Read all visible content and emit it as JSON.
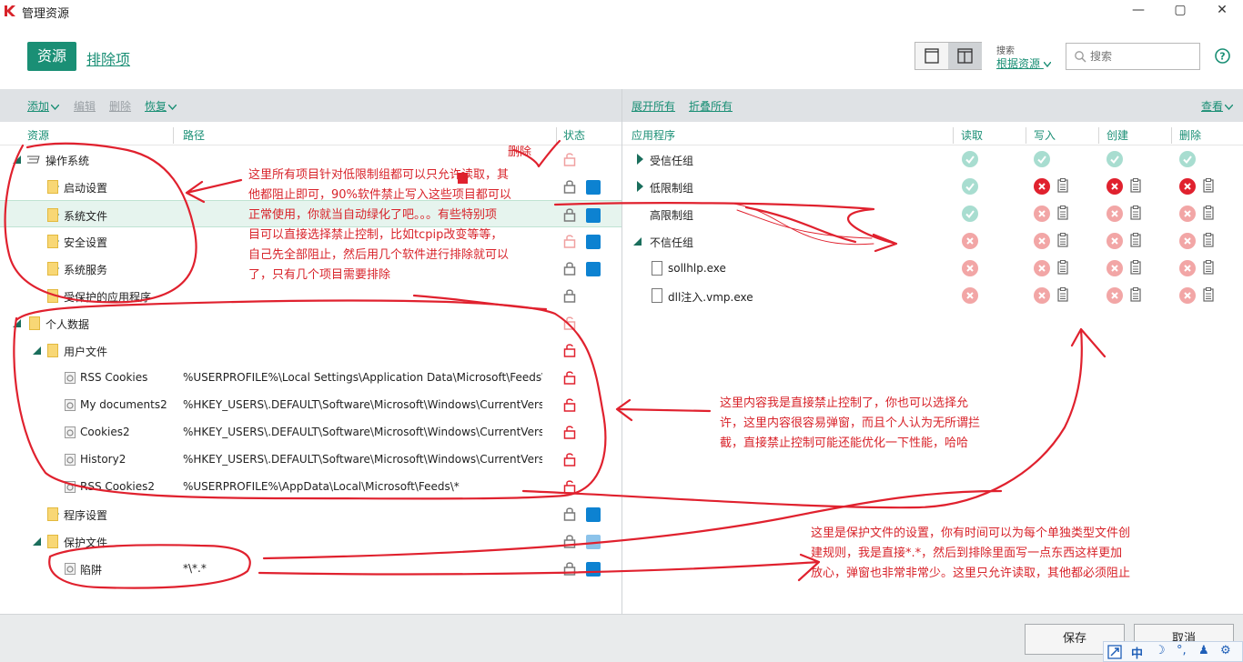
{
  "window": {
    "title": "管理资源",
    "minimize": "—",
    "maximize": "▢",
    "close": "✕"
  },
  "header": {
    "tab_resources": "资源",
    "tab_exclusions": "排除项",
    "search_caption": "搜索",
    "search_mode": "根据资源",
    "search_placeholder": "搜索"
  },
  "toolbar": {
    "add": "添加",
    "edit": "编辑",
    "delete": "删除",
    "restore": "恢复",
    "expand_all": "展开所有",
    "collapse_all": "折叠所有",
    "view": "查看"
  },
  "left_columns": {
    "resource": "资源",
    "path": "路径",
    "status": "状态"
  },
  "right_columns": {
    "app": "应用程序",
    "read": "读取",
    "write": "写入",
    "create": "创建",
    "delete": "删除"
  },
  "tree": [
    {
      "label": "操作系统",
      "path": "",
      "level": 0,
      "expand": "open",
      "icon": "computer-icon",
      "lock": "open-light",
      "square": "none"
    },
    {
      "label": "启动设置",
      "path": "",
      "level": 1,
      "expand": "closed",
      "icon": "folder-icon",
      "lock": "closed",
      "square": "blue"
    },
    {
      "label": "系统文件",
      "path": "",
      "level": 1,
      "expand": "closed",
      "icon": "folder-icon",
      "lock": "closed",
      "square": "blue",
      "selected": true
    },
    {
      "label": "安全设置",
      "path": "",
      "level": 1,
      "expand": "closed",
      "icon": "folder-icon",
      "lock": "open-light",
      "square": "blue"
    },
    {
      "label": "系统服务",
      "path": "",
      "level": 1,
      "expand": "closed",
      "icon": "folder-icon",
      "lock": "closed",
      "square": "blue"
    },
    {
      "label": "受保护的应用程序",
      "path": "",
      "level": 1,
      "expand": "closed",
      "icon": "folder-icon",
      "lock": "closed",
      "square": "none"
    },
    {
      "label": "个人数据",
      "path": "",
      "level": 0,
      "expand": "open",
      "icon": "folder-icon",
      "lock": "open-light",
      "square": "none"
    },
    {
      "label": "用户文件",
      "path": "",
      "level": 1,
      "expand": "open",
      "icon": "folder-icon",
      "lock": "open-red",
      "square": "none"
    },
    {
      "label": "RSS Cookies",
      "path": "%USERPROFILE%\\Local Settings\\Application Data\\Microsoft\\Feeds\\*",
      "level": 2,
      "expand": "none",
      "icon": "gear-icon",
      "lock": "open-red",
      "square": "none"
    },
    {
      "label": "My documents2",
      "path": "%HKEY_USERS\\.DEFAULT\\Software\\Microsoft\\Windows\\CurrentVersion\\E...",
      "level": 2,
      "expand": "none",
      "icon": "gear-icon",
      "lock": "open-red",
      "square": "none"
    },
    {
      "label": "Cookies2",
      "path": "%HKEY_USERS\\.DEFAULT\\Software\\Microsoft\\Windows\\CurrentVersion\\E...",
      "level": 2,
      "expand": "none",
      "icon": "gear-icon",
      "lock": "open-red",
      "square": "none"
    },
    {
      "label": "History2",
      "path": "%HKEY_USERS\\.DEFAULT\\Software\\Microsoft\\Windows\\CurrentVersion\\E...",
      "level": 2,
      "expand": "none",
      "icon": "gear-icon",
      "lock": "open-red",
      "square": "none"
    },
    {
      "label": "RSS Cookies2",
      "path": "%USERPROFILE%\\AppData\\Local\\Microsoft\\Feeds\\*",
      "level": 2,
      "expand": "none",
      "icon": "gear-icon",
      "lock": "open-red",
      "square": "none"
    },
    {
      "label": "程序设置",
      "path": "",
      "level": 1,
      "expand": "closed",
      "icon": "folder-icon",
      "lock": "closed",
      "square": "blue"
    },
    {
      "label": "保护文件",
      "path": "",
      "level": 1,
      "expand": "open",
      "icon": "folder-icon",
      "lock": "closed",
      "square": "light"
    },
    {
      "label": "陷阱",
      "path": "*\\*.*",
      "level": 2,
      "expand": "none",
      "icon": "gear-icon",
      "lock": "closed",
      "square": "blue"
    }
  ],
  "groups": [
    {
      "label": "受信任组",
      "expand": "closed",
      "file": false,
      "read": "allow",
      "write": "allow",
      "create": "allow",
      "delete": "allow"
    },
    {
      "label": "低限制组",
      "expand": "closed",
      "file": false,
      "read": "allow",
      "write": "block",
      "create": "block",
      "delete": "block"
    },
    {
      "label": "高限制组",
      "expand": "none",
      "file": false,
      "read": "allow",
      "write": "deny",
      "create": "deny",
      "delete": "deny"
    },
    {
      "label": "不信任组",
      "expand": "open",
      "file": false,
      "read": "deny",
      "write": "deny",
      "create": "deny",
      "delete": "deny"
    },
    {
      "label": "sollhlp.exe",
      "expand": "none",
      "file": true,
      "read": "deny",
      "write": "deny",
      "create": "deny",
      "delete": "deny"
    },
    {
      "label": "dll注入.vmp.exe",
      "expand": "none",
      "file": true,
      "read": "deny",
      "write": "deny",
      "create": "deny",
      "delete": "deny"
    }
  ],
  "footer": {
    "save": "保存",
    "cancel": "取消"
  },
  "ime": {
    "lang": "中",
    "moon": "☽",
    "dots": "°,",
    "person": "♟",
    "gear": "⚙"
  },
  "annotations": {
    "delete_note": "删除",
    "note1": [
      "这里所有项目针对低限制组都可以只允许读取，其",
      "他都阻止即可，90%软件禁止写入这些项目都可以",
      "正常使用，你就当自动绿化了吧。。。有些特别项",
      "目可以直接选择禁止控制，比如tcpip改变等等，",
      "自己先全部阻止，然后用几个软件进行排除就可以",
      "了，只有几个项目需要排除"
    ],
    "note2": [
      "这里内容我是直接禁止控制了，你也可以选择允",
      "许，这里内容很容易弹窗，而且个人认为无所谓拦",
      "截，直接禁止控制可能还能优化一下性能，哈哈"
    ],
    "note3": [
      "这里是保护文件的设置，你有时间可以为每个单独类型文件创",
      "建规则，我是直接*.*，然后到排除里面写一点东西这样更加",
      "放心，弹窗也非常非常少。这里只允许读取，其他都必须阻止"
    ]
  }
}
